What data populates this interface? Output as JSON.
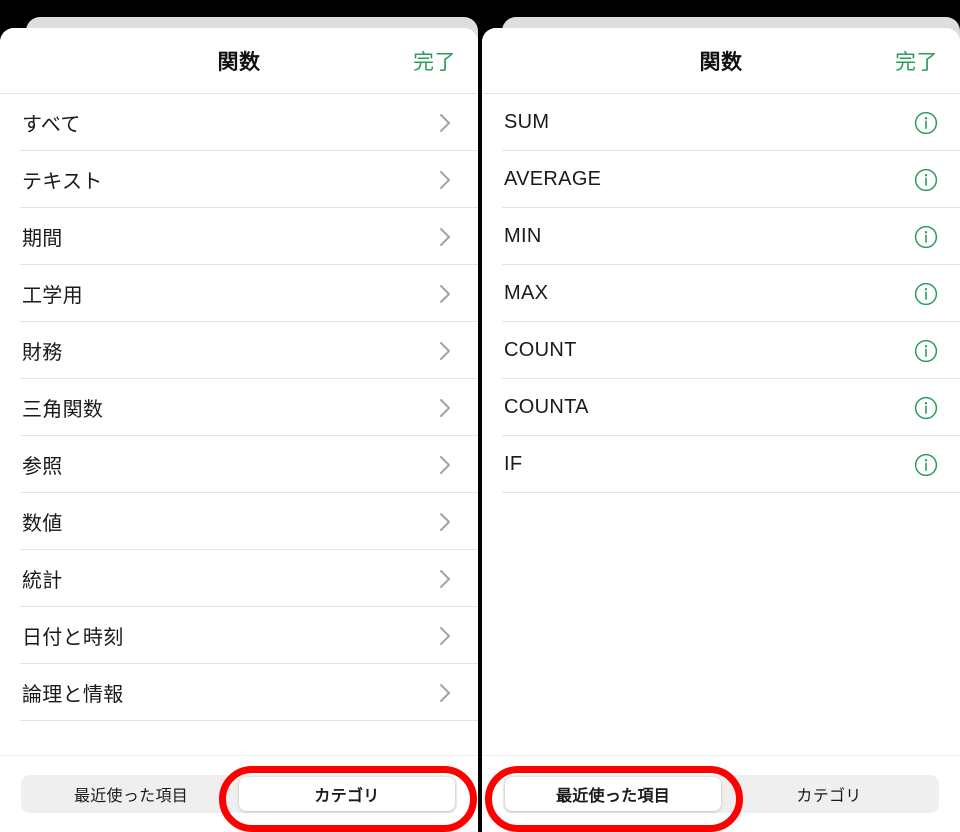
{
  "theme": {
    "accent_green": "#2b9c5a",
    "annotation_red": "#ff0000",
    "sheet_bg": "#ffffff",
    "backdrop": "#000000",
    "segmented_bg": "#efeff0",
    "divider": "#e3e3e5"
  },
  "panels": [
    {
      "id": "categories-panel",
      "header": {
        "title": "関数",
        "done_label": "完了"
      },
      "list": {
        "kind": "categories",
        "rows": [
          {
            "label": "すべて",
            "accessory": "chevron-right-icon"
          },
          {
            "label": "テキスト",
            "accessory": "chevron-right-icon"
          },
          {
            "label": "期間",
            "accessory": "chevron-right-icon"
          },
          {
            "label": "工学用",
            "accessory": "chevron-right-icon"
          },
          {
            "label": "財務",
            "accessory": "chevron-right-icon"
          },
          {
            "label": "三角関数",
            "accessory": "chevron-right-icon"
          },
          {
            "label": "参照",
            "accessory": "chevron-right-icon"
          },
          {
            "label": "数値",
            "accessory": "chevron-right-icon"
          },
          {
            "label": "統計",
            "accessory": "chevron-right-icon"
          },
          {
            "label": "日付と時刻",
            "accessory": "chevron-right-icon"
          },
          {
            "label": "論理と情報",
            "accessory": "chevron-right-icon"
          }
        ]
      },
      "tabs": [
        {
          "label": "最近使った項目",
          "selected": false
        },
        {
          "label": "カテゴリ",
          "selected": true
        }
      ],
      "annotation": {
        "shape": "ellipse",
        "target": "カテゴリ",
        "color": "#ff0000"
      }
    },
    {
      "id": "recents-panel",
      "header": {
        "title": "関数",
        "done_label": "完了"
      },
      "list": {
        "kind": "functions",
        "rows": [
          {
            "label": "SUM",
            "accessory": "info-circle-icon"
          },
          {
            "label": "AVERAGE",
            "accessory": "info-circle-icon"
          },
          {
            "label": "MIN",
            "accessory": "info-circle-icon"
          },
          {
            "label": "MAX",
            "accessory": "info-circle-icon"
          },
          {
            "label": "COUNT",
            "accessory": "info-circle-icon"
          },
          {
            "label": "COUNTA",
            "accessory": "info-circle-icon"
          },
          {
            "label": "IF",
            "accessory": "info-circle-icon"
          }
        ]
      },
      "tabs": [
        {
          "label": "最近使った項目",
          "selected": true
        },
        {
          "label": "カテゴリ",
          "selected": false
        }
      ],
      "annotation": {
        "shape": "ellipse",
        "target": "最近使った項目",
        "color": "#ff0000"
      }
    }
  ]
}
